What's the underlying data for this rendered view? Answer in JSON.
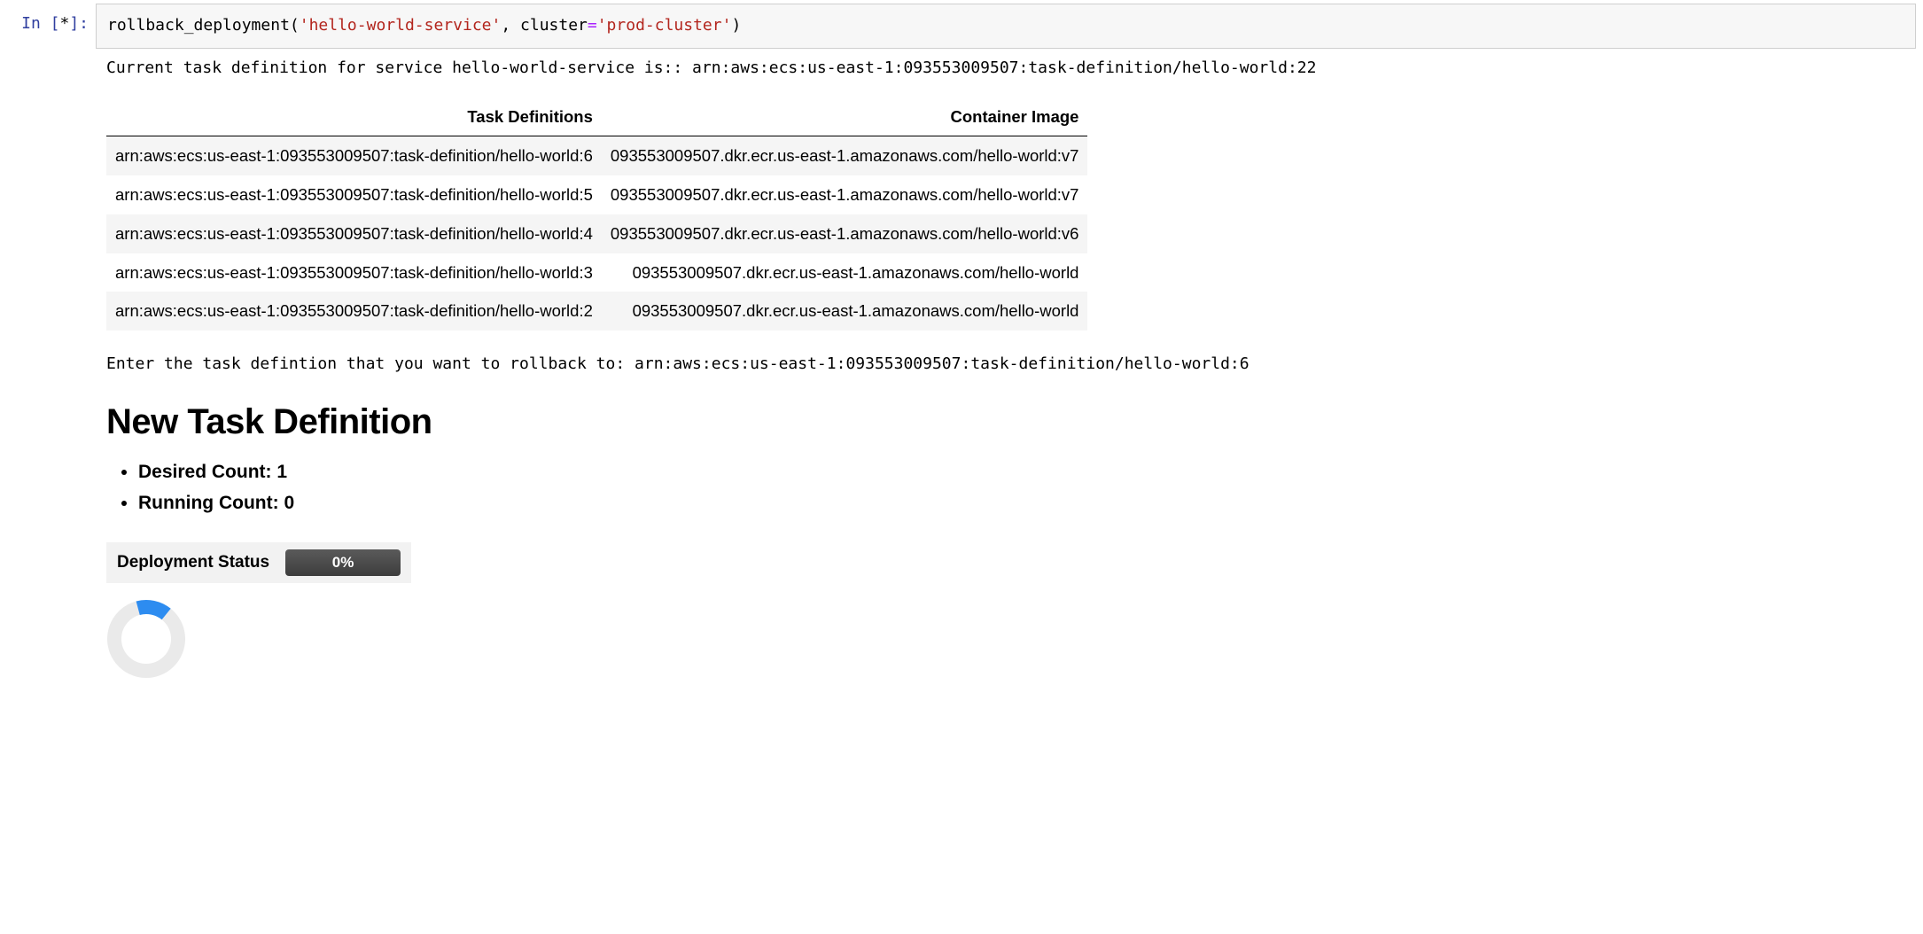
{
  "prompt": {
    "prefix": "In [",
    "exec": "*",
    "suffix": "]:"
  },
  "code": {
    "fn": "rollback_deployment",
    "open": "(",
    "arg1": "'hello-world-service'",
    "comma": ", ",
    "kw": "cluster",
    "eq": "=",
    "arg2": "'prod-cluster'",
    "close": ")"
  },
  "output": {
    "current_line": "Current task definition for service hello-world-service is:: arn:aws:ecs:us-east-1:093553009507:task-definition/hello-world:22",
    "table": {
      "headers": [
        "Task Definitions",
        "Container Image"
      ],
      "rows": [
        {
          "td": "arn:aws:ecs:us-east-1:093553009507:task-definition/hello-world:6",
          "img": "093553009507.dkr.ecr.us-east-1.amazonaws.com/hello-world:v7"
        },
        {
          "td": "arn:aws:ecs:us-east-1:093553009507:task-definition/hello-world:5",
          "img": "093553009507.dkr.ecr.us-east-1.amazonaws.com/hello-world:v7"
        },
        {
          "td": "arn:aws:ecs:us-east-1:093553009507:task-definition/hello-world:4",
          "img": "093553009507.dkr.ecr.us-east-1.amazonaws.com/hello-world:v6"
        },
        {
          "td": "arn:aws:ecs:us-east-1:093553009507:task-definition/hello-world:3",
          "img": "093553009507.dkr.ecr.us-east-1.amazonaws.com/hello-world"
        },
        {
          "td": "arn:aws:ecs:us-east-1:093553009507:task-definition/hello-world:2",
          "img": "093553009507.dkr.ecr.us-east-1.amazonaws.com/hello-world"
        }
      ]
    },
    "prompt_line": "Enter the task defintion that you want to rollback to: arn:aws:ecs:us-east-1:093553009507:task-definition/hello-world:6",
    "section_title": "New Task Definition",
    "counts": [
      "Desired Count: 1",
      "Running Count: 0"
    ],
    "status": {
      "label": "Deployment Status",
      "percent": "0%"
    },
    "spinner": {
      "percent": 15,
      "color": "#2d8cf0",
      "track": "#eaeaea"
    }
  }
}
